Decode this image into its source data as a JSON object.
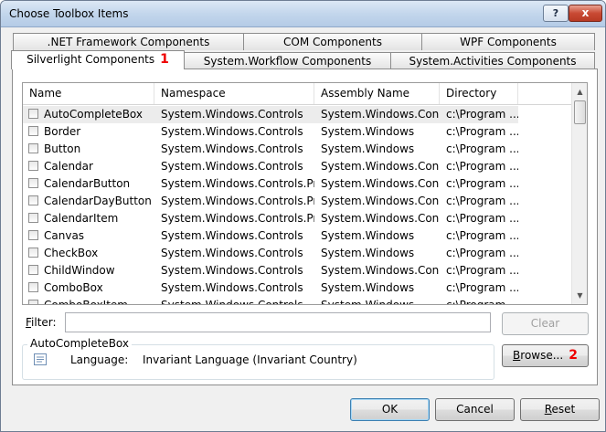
{
  "window": {
    "title": "Choose Toolbox Items",
    "help_glyph": "?",
    "close_glyph": "x"
  },
  "tabs": {
    "row1": [
      ".NET Framework Components",
      "COM Components",
      "WPF Components"
    ],
    "row2": [
      "Silverlight Components",
      "System.Workflow Components",
      "System.Activities Components"
    ],
    "selected": "Silverlight Components",
    "marker": "1"
  },
  "grid": {
    "columns": [
      "Name",
      "Namespace",
      "Assembly Name",
      "Directory"
    ],
    "rows": [
      {
        "name": "AutoCompleteBox",
        "namespace": "System.Windows.Controls",
        "assembly": "System.Windows.Con...",
        "directory": "c:\\Program ...",
        "selected": true
      },
      {
        "name": "Border",
        "namespace": "System.Windows.Controls",
        "assembly": "System.Windows",
        "directory": "c:\\Program ..."
      },
      {
        "name": "Button",
        "namespace": "System.Windows.Controls",
        "assembly": "System.Windows",
        "directory": "c:\\Program ..."
      },
      {
        "name": "Calendar",
        "namespace": "System.Windows.Controls",
        "assembly": "System.Windows.Con...",
        "directory": "c:\\Program ..."
      },
      {
        "name": "CalendarButton",
        "namespace": "System.Windows.Controls.Pr...",
        "assembly": "System.Windows.Con...",
        "directory": "c:\\Program ..."
      },
      {
        "name": "CalendarDayButton",
        "namespace": "System.Windows.Controls.Pr...",
        "assembly": "System.Windows.Con...",
        "directory": "c:\\Program ..."
      },
      {
        "name": "CalendarItem",
        "namespace": "System.Windows.Controls.Pr...",
        "assembly": "System.Windows.Con...",
        "directory": "c:\\Program ..."
      },
      {
        "name": "Canvas",
        "namespace": "System.Windows.Controls",
        "assembly": "System.Windows",
        "directory": "c:\\Program ..."
      },
      {
        "name": "CheckBox",
        "namespace": "System.Windows.Controls",
        "assembly": "System.Windows",
        "directory": "c:\\Program ..."
      },
      {
        "name": "ChildWindow",
        "namespace": "System.Windows.Controls",
        "assembly": "System.Windows.Con...",
        "directory": "c:\\Program ..."
      },
      {
        "name": "ComboBox",
        "namespace": "System.Windows.Controls",
        "assembly": "System.Windows",
        "directory": "c:\\Program ..."
      },
      {
        "name": "ComboBoxItem",
        "namespace": "System.Windows.Controls",
        "assembly": "System.Windows",
        "directory": "c:\\Program ..."
      }
    ]
  },
  "filter": {
    "label_prefix": "F",
    "label_rest": "ilter:",
    "value": ""
  },
  "buttons": {
    "clear": "Clear",
    "browse_prefix": "B",
    "browse_rest": "rowse...",
    "browse_marker": "2",
    "ok": "OK",
    "cancel": "Cancel",
    "reset_prefix": "R",
    "reset_rest": "eset"
  },
  "details": {
    "title": "AutoCompleteBox",
    "language_label": "Language:",
    "language_value": "Invariant Language (Invariant Country)"
  },
  "icons": {
    "document": "document-icon",
    "scroll_up": "scroll-up-arrow",
    "scroll_down": "scroll-down-arrow"
  },
  "colors": {
    "marker": "#e00000",
    "default_button_border": "#3c7fb1"
  }
}
